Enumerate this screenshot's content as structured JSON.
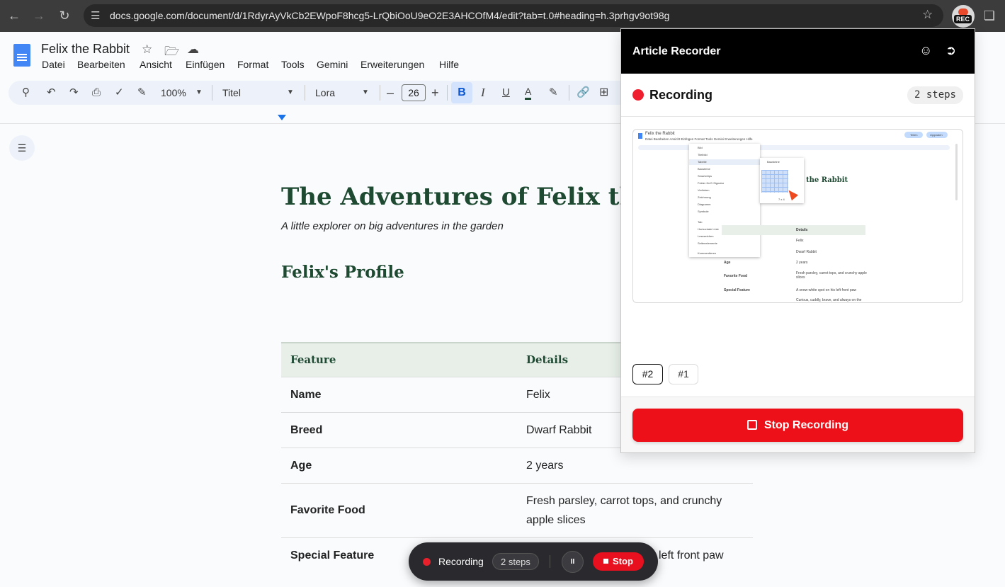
{
  "browser": {
    "url": "docs.google.com/document/d/1RdyrAyVkCb2EWpoF8hcg5-LrQbiOoU9eO2E3AHCOfM4/edit?tab=t.0#heading=h.3prhgv9ot98g",
    "rec_badge": "REC"
  },
  "docs": {
    "title": "Felix the Rabbit",
    "menu": [
      "Datei",
      "Bearbeiten",
      "Ansicht",
      "Einfügen",
      "Format",
      "Tools",
      "Gemini",
      "Erweiterungen",
      "Hilfe"
    ],
    "toolbar": {
      "zoom": "100%",
      "style": "Titel",
      "font": "Lora",
      "font_size": "26",
      "bold": "B",
      "italic": "I",
      "underline": "U",
      "text_color": "A"
    }
  },
  "document": {
    "heading": "The Adventures of Felix the R",
    "subtitle": "A little explorer on big adventures in the garden",
    "section_title": "Felix's Profile",
    "table": {
      "headers": [
        "Feature",
        "Details"
      ],
      "rows": [
        [
          "Name",
          "Felix"
        ],
        [
          "Breed",
          "Dwarf Rabbit"
        ],
        [
          "Age",
          "2 years"
        ],
        [
          "Favorite Food",
          "Fresh parsley, carrot tops, and crunchy apple slices"
        ],
        [
          "Special Feature",
          "left front paw"
        ]
      ]
    }
  },
  "pill": {
    "label": "Recording",
    "steps": "2 steps",
    "pause_icon": "II",
    "stop": "Stop"
  },
  "panel": {
    "title": "Article Recorder",
    "status": "Recording",
    "steps": "2 steps",
    "step_buttons": [
      "#2",
      "#1"
    ],
    "stop_button": "Stop Recording",
    "preview": {
      "doc_title": "Felix the Rabbit",
      "menu": "Datei  Bearbeiten  Ansicht  Einfügen  Format  Tools  Gemini  Erweiterungen  Hilfe",
      "dropdown_items": [
        "Bild",
        "Titelbild",
        "Tabelle",
        "Bausteine",
        "Smartchips",
        "Felder für E-Signatur",
        "Verlinken",
        "Zeichnung",
        "Diagramm",
        "Symbole",
        "Tab",
        "Horizontale Linie",
        "Lesezeichen",
        "Seitenelemente",
        "Kommentieren"
      ],
      "submenu": "Bausteine",
      "grid_label": "7 x 4",
      "heading_fragment": "the Rabbit",
      "table_header": "Details",
      "table_keys": [
        "Age",
        "Favorite Food",
        "Special Feature"
      ],
      "table_values": [
        "Felix",
        "Dwarf Rabbit",
        "2 years",
        "Fresh parsley, carrot tops, and crunchy apple slices",
        "A snow-white spot on his left front paw",
        "Curious, cuddly, brave, and always on the"
      ],
      "share": "Teilen",
      "upgrade": "Upgraden"
    }
  }
}
